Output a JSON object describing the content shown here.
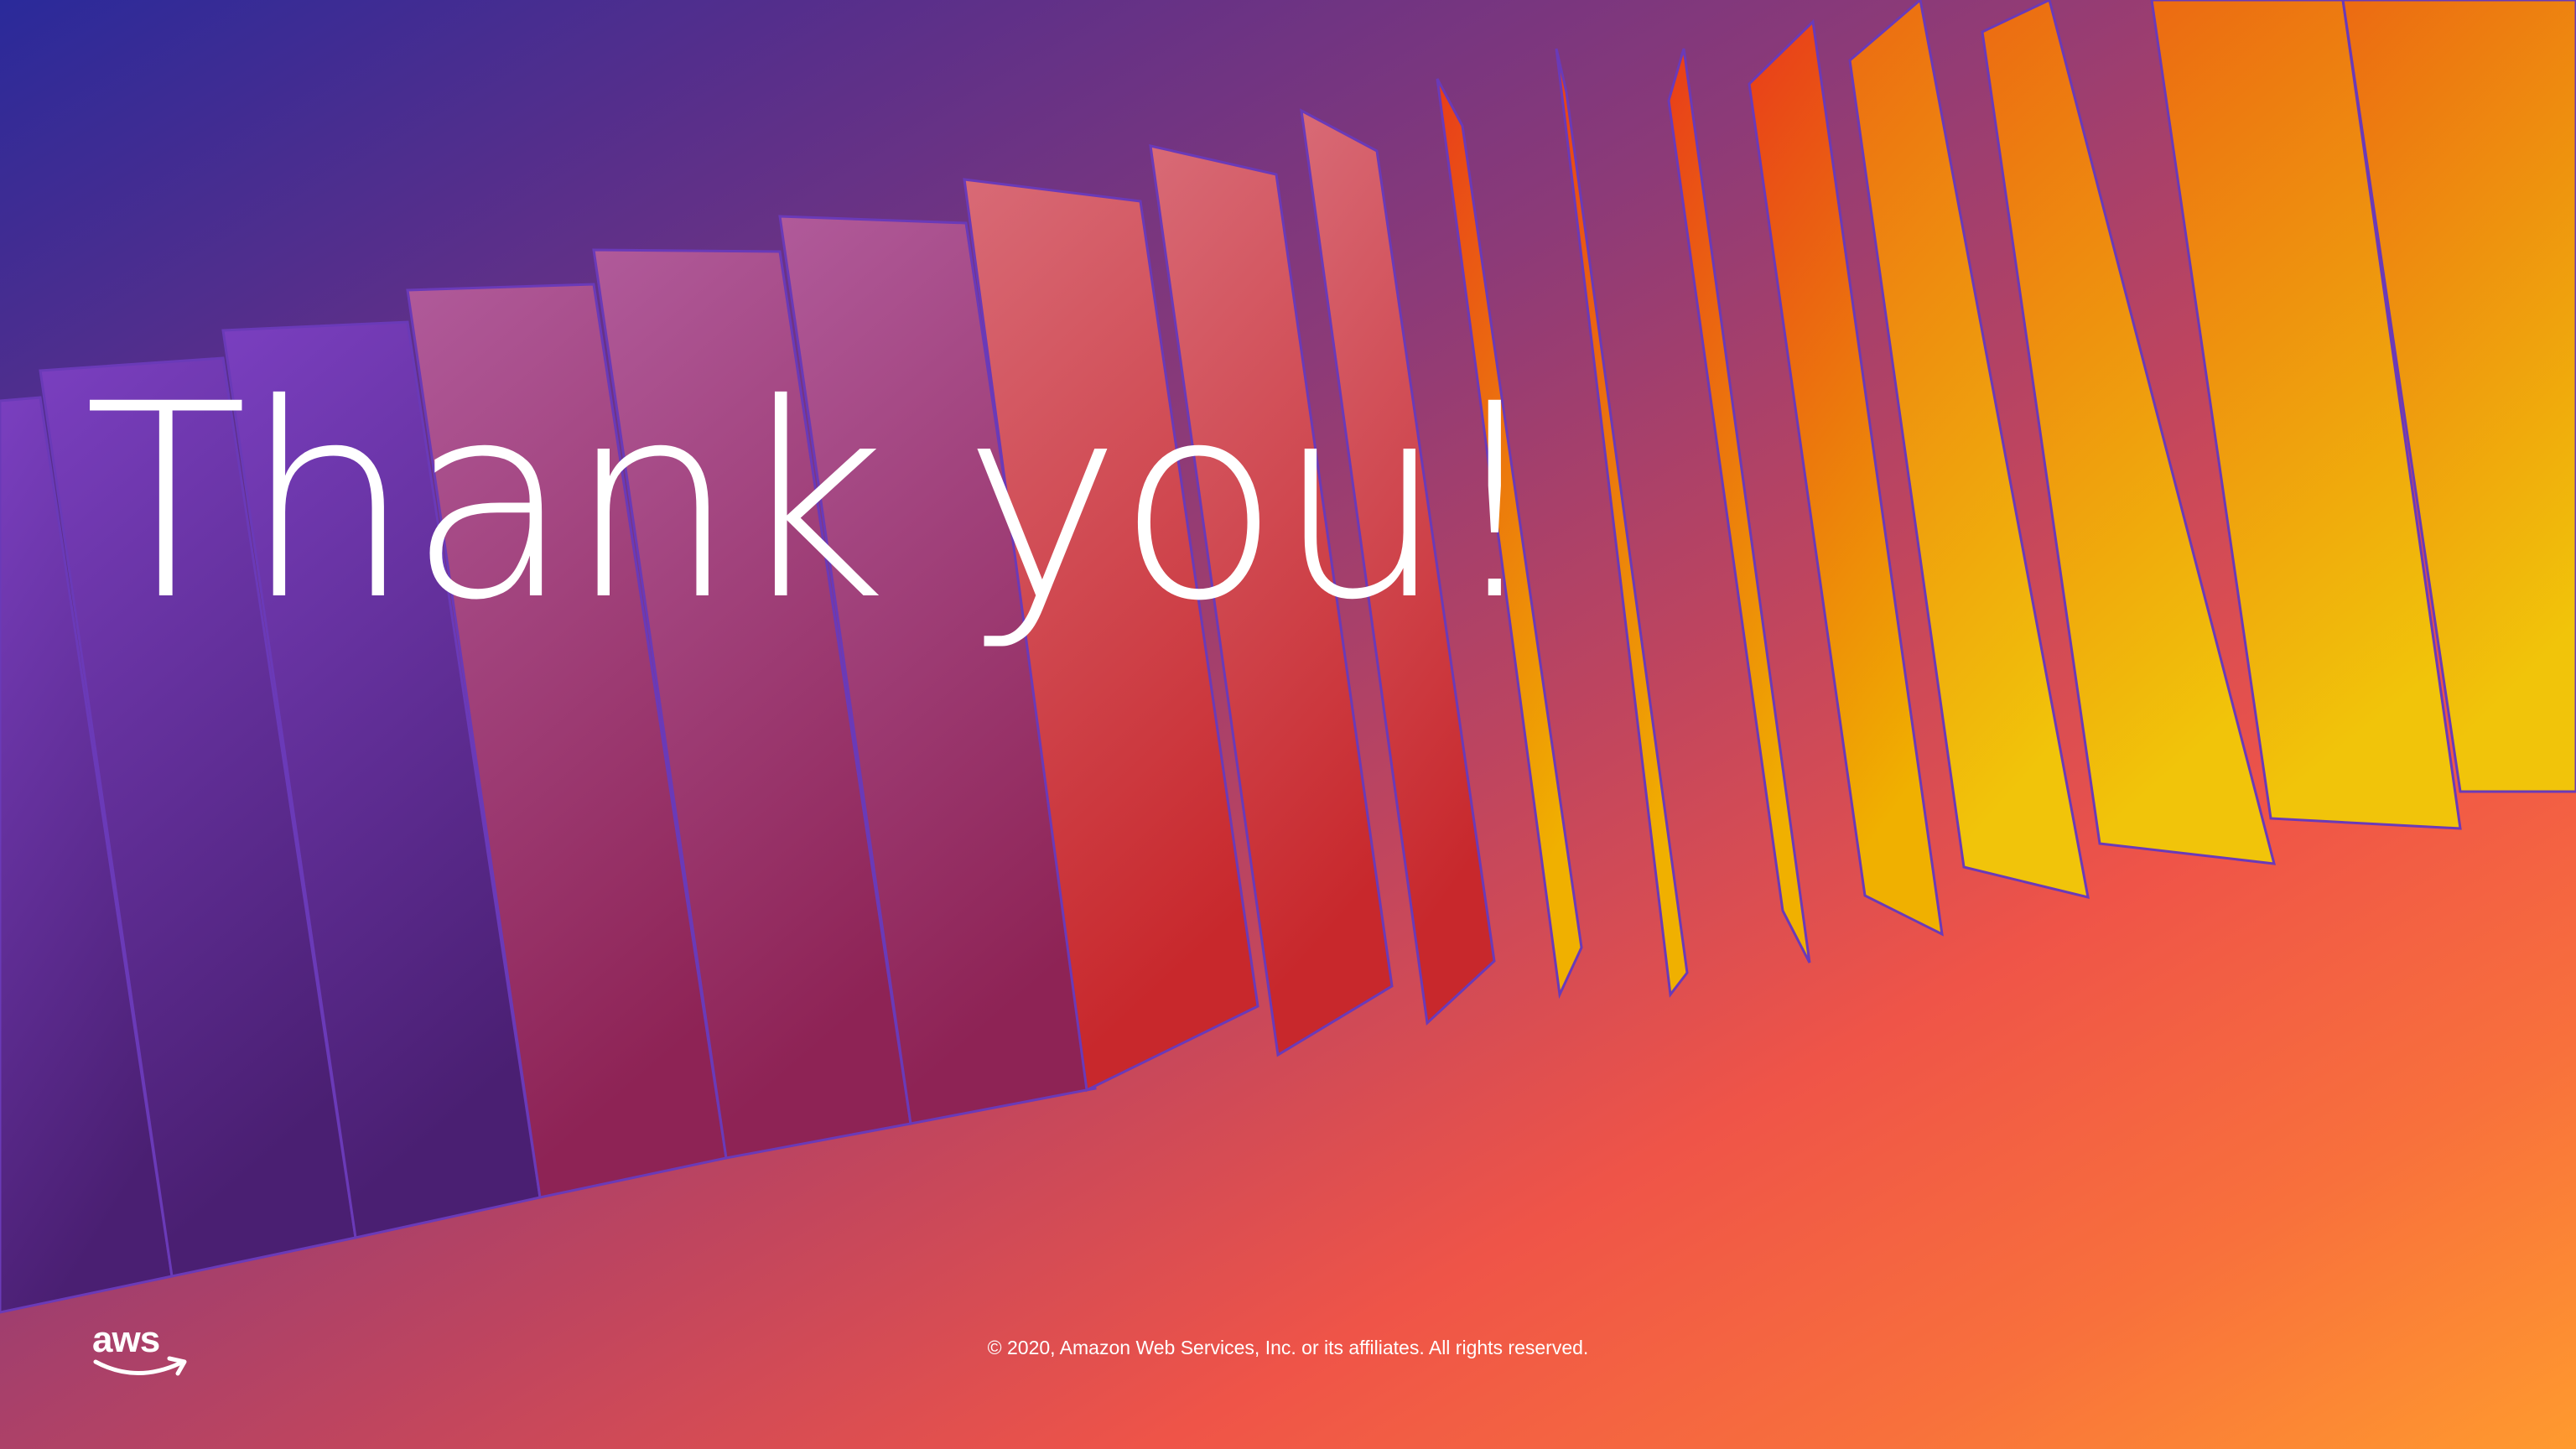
{
  "slide": {
    "title": "Thank you!",
    "copyright": "© 2020, Amazon Web Services, Inc. or its affiliates. All rights reserved.",
    "logo": {
      "text": "aws",
      "icon": "aws-logo-icon"
    }
  },
  "colors": {
    "text": "#ffffff",
    "gradient_start": "#2a2a9a",
    "gradient_mid": "#c0455e",
    "gradient_end": "#ff9a2e"
  }
}
